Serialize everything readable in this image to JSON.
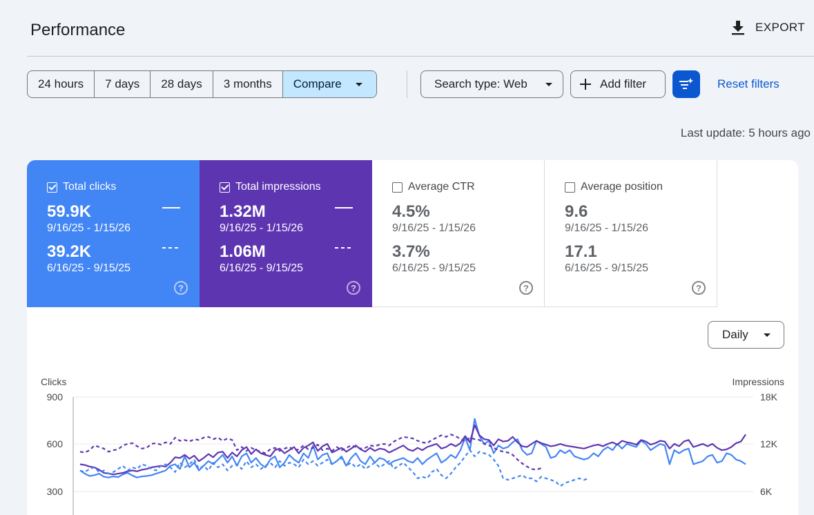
{
  "header": {
    "title": "Performance",
    "export_label": "EXPORT"
  },
  "toolbar": {
    "ranges": [
      "24 hours",
      "7 days",
      "28 days",
      "3 months"
    ],
    "compare_label": "Compare",
    "search_type_label": "Search type: Web",
    "add_filter_label": "Add filter",
    "reset_label": "Reset filters"
  },
  "last_update": "Last update: 5 hours ago",
  "metrics": [
    {
      "label": "Total clicks",
      "checked": true,
      "value1": "59.9K",
      "date1": "9/16/25 - 1/15/26",
      "value2": "39.2K",
      "date2": "6/16/25 - 9/15/25",
      "color": "#4285f4"
    },
    {
      "label": "Total impressions",
      "checked": true,
      "value1": "1.32M",
      "date1": "9/16/25 - 1/15/26",
      "value2": "1.06M",
      "date2": "6/16/25 - 9/15/25",
      "color": "#5e35b1"
    },
    {
      "label": "Average CTR",
      "checked": false,
      "value1": "4.5%",
      "date1": "9/16/25 - 1/15/26",
      "value2": "3.7%",
      "date2": "6/16/25 - 9/15/25",
      "color": "#ffffff"
    },
    {
      "label": "Average position",
      "checked": false,
      "value1": "9.6",
      "date1": "9/16/25 - 1/15/26",
      "value2": "17.1",
      "date2": "6/16/25 - 9/15/25",
      "color": "#ffffff"
    }
  ],
  "granularity_label": "Daily",
  "chart_data": {
    "type": "line",
    "ylabel": "Clicks",
    "ylabel_right": "Impressions",
    "yticks_left": [
      "900",
      "600",
      "300"
    ],
    "yticks_right": [
      "18K",
      "12K",
      "6K"
    ],
    "ylim_left": [
      0,
      900
    ],
    "ylim_right": [
      0,
      18000
    ],
    "grid": true,
    "series": [
      {
        "name": "Total clicks",
        "axis": "left",
        "style": "solid",
        "color": "#4285f4",
        "values": [
          430,
          410,
          395,
          400,
          410,
          390,
          385,
          392,
          388,
          405,
          415,
          398,
          385,
          392,
          395,
          400,
          410,
          420,
          430,
          460,
          470,
          440,
          520,
          450,
          480,
          430,
          460,
          490,
          470,
          500,
          530,
          480,
          520,
          460,
          520,
          540,
          480,
          510,
          470,
          450,
          500,
          520,
          450,
          480,
          530,
          500,
          480,
          540,
          510,
          590,
          500,
          530,
          540,
          470,
          490,
          520,
          460,
          510,
          540,
          490,
          470,
          520,
          480,
          510,
          500,
          470,
          490,
          500,
          510,
          490,
          480,
          510,
          470,
          500,
          520,
          540,
          480,
          500,
          530,
          510,
          560,
          640,
          560,
          760,
          650,
          600,
          620,
          540,
          590,
          570,
          580,
          610,
          630,
          560,
          530,
          540,
          620,
          600,
          580,
          510,
          520,
          560,
          540,
          560,
          520,
          510,
          500,
          510,
          540,
          520,
          560,
          580,
          560,
          600,
          570,
          600,
          590,
          580,
          620,
          600,
          560,
          580,
          600,
          590,
          470,
          560,
          540,
          560,
          570,
          470,
          480,
          490,
          520,
          530,
          480,
          490,
          540,
          530,
          500,
          490,
          470
        ]
      },
      {
        "name": "Total impressions",
        "axis": "right",
        "style": "solid",
        "color": "#5e35b1",
        "values": [
          9400,
          9300,
          9100,
          9000,
          8700,
          8300,
          8200,
          8100,
          8200,
          8300,
          8500,
          8600,
          8500,
          8700,
          8800,
          9000,
          9100,
          9200,
          9100,
          9600,
          10300,
          10200,
          10600,
          10100,
          10500,
          9800,
          10200,
          10700,
          10300,
          10900,
          11000,
          10200,
          10900,
          10400,
          11200,
          11600,
          10700,
          11300,
          10800,
          10600,
          10400,
          11200,
          11400,
          10800,
          11200,
          11600,
          10800,
          11500,
          11800,
          12200,
          11100,
          11700,
          12000,
          10900,
          11200,
          11500,
          11000,
          11400,
          11800,
          11300,
          11000,
          11500,
          11100,
          11400,
          11300,
          10900,
          11200,
          11500,
          11800,
          11300,
          11100,
          11500,
          11200,
          11600,
          11800,
          12000,
          11400,
          11600,
          12000,
          11700,
          12100,
          13000,
          12200,
          14400,
          13100,
          12600,
          12500,
          11800,
          12600,
          12300,
          12400,
          12900,
          12200,
          11700,
          11600,
          12000,
          12400,
          12100,
          11900,
          11700,
          11800,
          12000,
          11800,
          11700,
          11600,
          11500,
          11400,
          11600,
          11800,
          11900,
          11700,
          12000,
          12200,
          11900,
          12400,
          12200,
          12100,
          11900,
          12500,
          12300,
          11900,
          12100,
          12400,
          12300,
          11400,
          12000,
          11700,
          12300,
          12500,
          11600,
          11800,
          12000,
          11700,
          12000,
          11500,
          11200,
          11300,
          11600,
          12100,
          12300,
          13200
        ]
      },
      {
        "name": "Total clicks (previous)",
        "axis": "left",
        "style": "dashed",
        "color": "#4285f4",
        "values": [
          430,
          420,
          440,
          450,
          420,
          430,
          410,
          420,
          440,
          460,
          430,
          450,
          440,
          470,
          460,
          440,
          430,
          460,
          470,
          450,
          420,
          480,
          450,
          470,
          500,
          440,
          460,
          430,
          480,
          450,
          470,
          430,
          460,
          470,
          440,
          490,
          450,
          470,
          440,
          460,
          480,
          450,
          490,
          460,
          480,
          470,
          450,
          500,
          470,
          490,
          460,
          480,
          500,
          470,
          490,
          510,
          460,
          480,
          450,
          470,
          440,
          460,
          480,
          450,
          470,
          490,
          440,
          460,
          480,
          450,
          420,
          380,
          390,
          380,
          420,
          440,
          400,
          380,
          410,
          450,
          480,
          520,
          560,
          520,
          550,
          540,
          530,
          500,
          460,
          380,
          370,
          380,
          390,
          400,
          380,
          380,
          360,
          390,
          380,
          370,
          360,
          330,
          350,
          360,
          370,
          380,
          370,
          380
        ]
      },
      {
        "name": "Total impressions (previous)",
        "axis": "right",
        "style": "dashed",
        "color": "#5e35b1",
        "values": [
          11000,
          10900,
          11200,
          11800,
          11600,
          11400,
          11000,
          11200,
          11300,
          11800,
          12000,
          12100,
          11700,
          11400,
          11500,
          12000,
          12100,
          11900,
          12200,
          12000,
          12800,
          12400,
          12500,
          12300,
          12600,
          12500,
          12800,
          12900,
          12600,
          12800,
          12400,
          12700,
          12500,
          11200,
          11600,
          11100,
          11500,
          11200,
          11000,
          10800,
          11300,
          11500,
          11100,
          11400,
          11600,
          11200,
          11300,
          11800,
          11300,
          11500,
          11900,
          11200,
          11400,
          11100,
          11600,
          11200,
          11500,
          11800,
          11600,
          11400,
          11500,
          11800,
          11700,
          11900,
          12000,
          11800,
          12300,
          12600,
          12900,
          12800,
          12700,
          12400,
          12200,
          12100,
          12500,
          12800,
          13100,
          12900,
          13200,
          13000,
          12600,
          12300,
          12800,
          12600,
          12500,
          12000,
          11800,
          11500,
          11200,
          11000,
          10900,
          10600,
          10000,
          9500,
          9100,
          8800,
          8700,
          8900
        ]
      }
    ]
  }
}
